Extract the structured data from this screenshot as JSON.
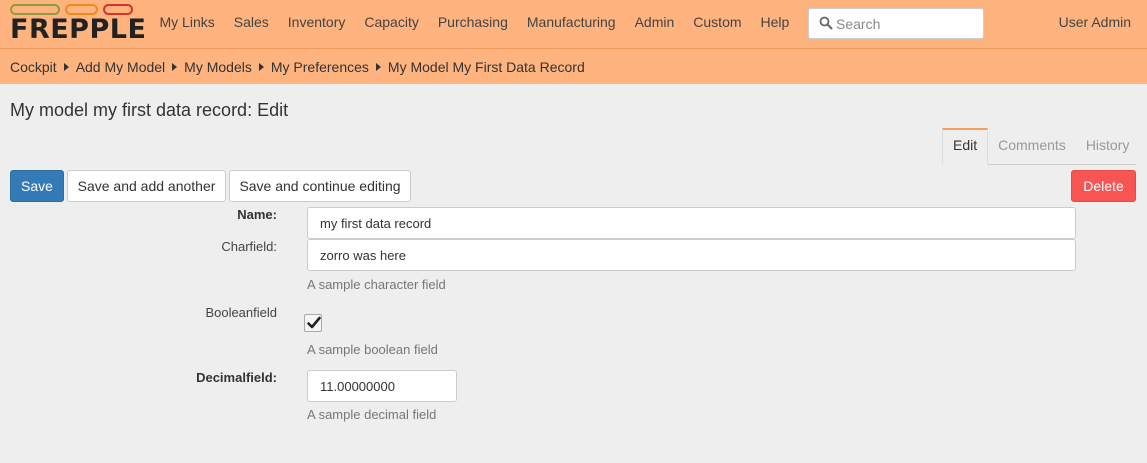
{
  "logo": {
    "text": "FREPPLE"
  },
  "menu": [
    "My Links",
    "Sales",
    "Inventory",
    "Capacity",
    "Purchasing",
    "Manufacturing",
    "Admin",
    "Custom",
    "Help"
  ],
  "search": {
    "placeholder": "Search",
    "icon": "search-icon"
  },
  "user": {
    "label": "User Admin"
  },
  "breadcrumbs": [
    "Cockpit",
    "Add My Model",
    "My Models",
    "My Preferences",
    "My Model My First Data Record"
  ],
  "page": {
    "title": "My model my first data record: Edit"
  },
  "tabs": [
    "Edit",
    "Comments",
    "History"
  ],
  "actions": {
    "save": "Save",
    "save_add": "Save and add another",
    "save_continue": "Save and continue editing",
    "delete": "Delete"
  },
  "form": {
    "name": {
      "label": "Name:",
      "value": "my first data record"
    },
    "charfield": {
      "label": "Charfield:",
      "value": "zorro was here",
      "help": "A sample character field"
    },
    "booleanfield": {
      "label": "Booleanfield",
      "checked": true,
      "help": "A sample boolean field"
    },
    "decimalfield": {
      "label": "Decimalfield:",
      "value": "11.00000000",
      "help": "A sample decimal field"
    }
  },
  "colors": {
    "navbar": "#ffb37e",
    "primary_button": "#337ab7",
    "danger_button": "#f75454",
    "background": "#eeeeee"
  }
}
